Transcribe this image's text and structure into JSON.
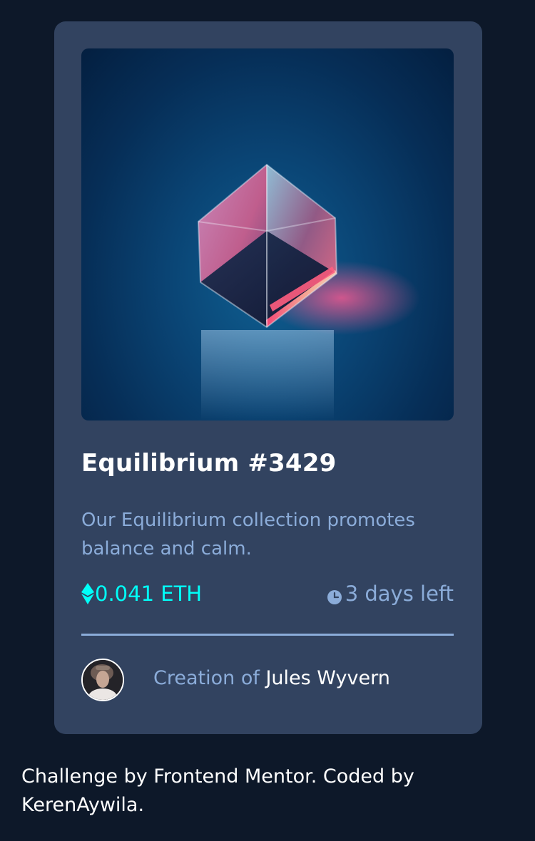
{
  "card": {
    "title": "Equilibrium #3429",
    "description": "Our Equilibrium collection promotes balance and calm.",
    "price": "0.041 ETH",
    "time_left": "3 days left",
    "creator_prefix": "Creation of",
    "creator_name": "Jules Wyvern"
  },
  "footer": {
    "attribution": "Challenge by Frontend Mentor. Coded by KerenAywila."
  },
  "icons": {
    "price": "ethereum-icon",
    "time": "clock-icon"
  },
  "colors": {
    "page_background": "#0d1829",
    "card_background": "#324360",
    "accent_cyan": "#00fff8",
    "soft_blue": "#8bacd9",
    "white": "#ffffff"
  }
}
